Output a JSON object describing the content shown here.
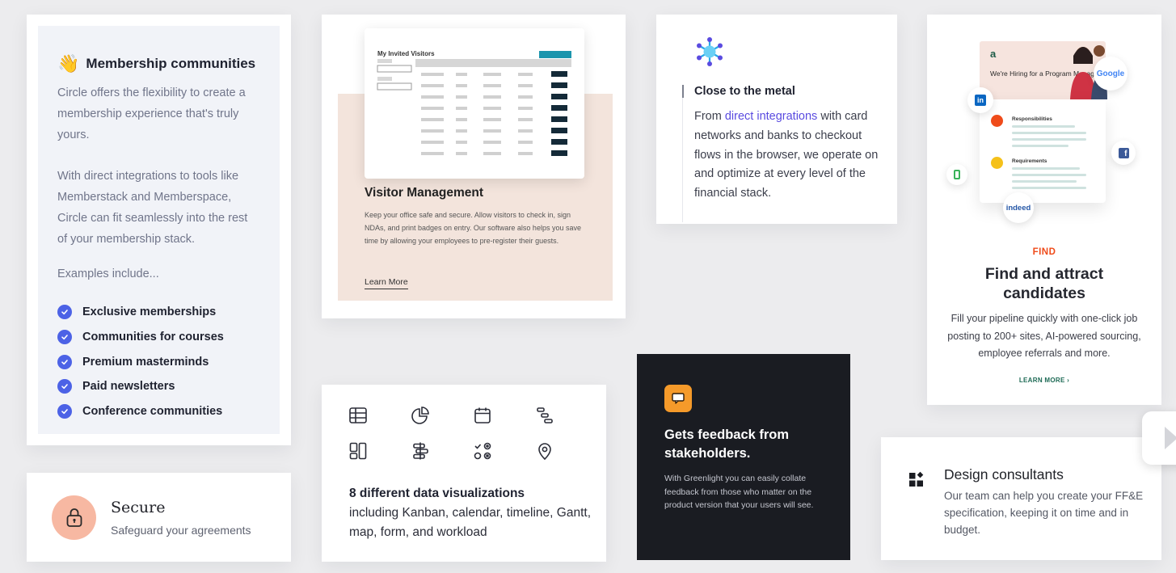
{
  "membership": {
    "emoji": "👋",
    "title": "Membership communities",
    "p1": "Circle offers the flexibility to create a membership experience that's truly yours.",
    "p2": "With direct integrations to tools like Memberstack and Memberspace, Circle can fit seamlessly into the rest of your membership stack.",
    "examples": "Examples include...",
    "items": [
      "Exclusive memberships",
      "Communities for courses",
      "Premium masterminds",
      "Paid newsletters",
      "Conference communities"
    ],
    "check_color": "#4c62e6"
  },
  "secure": {
    "title": "Secure",
    "subtitle": "Safeguard your agreements",
    "icon_bg": "#f7b8a2"
  },
  "visitor": {
    "mock_title": "My Invited Visitors",
    "title": "Visitor Management",
    "body": "Keep your office safe and secure. Allow visitors to check in, sign NDAs, and print badges on entry. Our software also helps you save time by allowing your employees to pre-register their guests.",
    "link": "Learn More",
    "accent": "#1b95ad",
    "panel_color": "#f3e4dc"
  },
  "dataviz": {
    "icons": [
      "table-icon",
      "pie-chart-icon",
      "calendar-icon",
      "timeline-icon",
      "kanban-icon",
      "gantt-icon",
      "form-icon",
      "map-pin-icon"
    ],
    "bold": "8 different data visualizations",
    "rest": "including Kanban, calendar, timeline, Gantt, map, form, and workload"
  },
  "metal": {
    "title": "Close to the metal",
    "pre": "From ",
    "link": "direct integrations",
    "post": " with card networks and banks to checkout flows in the browser, we operate on and optimize at every level of the financial stack.",
    "link_color": "#5a4be0",
    "icon": "network-snowflake-icon"
  },
  "feedback": {
    "title": "Gets feedback from stakeholders.",
    "body": "With Greenlight you can easily collate feedback from those who matter on the product version that your users will see.",
    "icon_color": "#f59a2a",
    "bg": "#1a1c22"
  },
  "find": {
    "hero_logo": "a",
    "hero_text": "We're Hiring for a Program Manager!",
    "panel_labels": [
      "Responsibilities",
      "Requirements"
    ],
    "google": "Google",
    "indeed": "indeed",
    "kicker": "FIND",
    "title": "Find and attract candidates",
    "body": "Fill your pipeline quickly with one-click job posting to 200+ sites, AI-powered sourcing, employee referrals and more.",
    "link": "LEARN MORE",
    "kicker_color": "#ef4b1a",
    "link_color": "#1d6a55"
  },
  "design": {
    "title": "Design consultants",
    "body": "Our team can help you create your FF&E specification, keeping it on time and in budget.",
    "icon": "grid-sparkle-icon"
  }
}
